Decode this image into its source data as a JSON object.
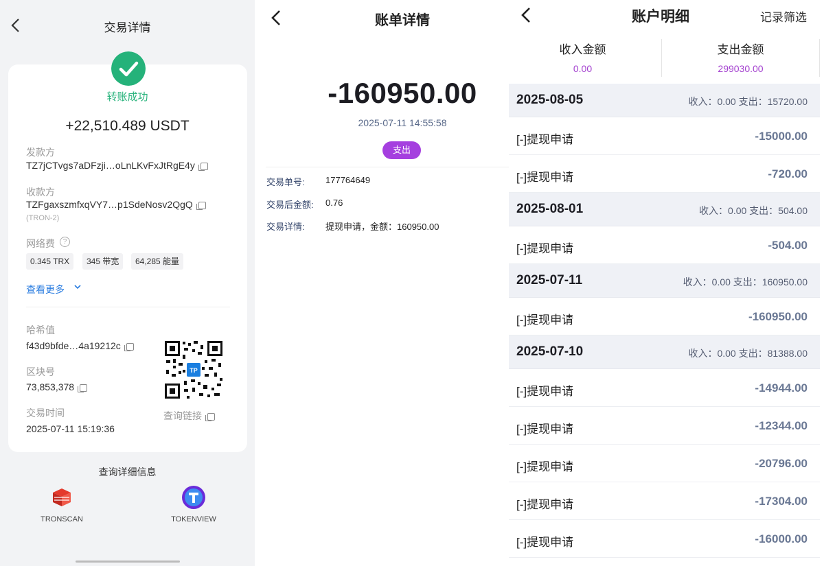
{
  "tx_detail": {
    "title": "交易详情",
    "status": "转账成功",
    "amount": "+22,510.489 USDT",
    "sender_label": "发款方",
    "sender_address": "TZ7jCTvgs7aDFzji…oLnLKvFxJtRgE4y",
    "receiver_label": "收款方",
    "receiver_address": "TZFgaxszmfxqVY7…p1SdeNosv2QgQ",
    "receiver_network": "(TRON-2)",
    "fee_label": "网络费",
    "fee_help": "?",
    "fees": [
      "0.345 TRX",
      "345 带宽",
      "64,285 能量"
    ],
    "see_more": "查看更多",
    "hash_label": "哈希值",
    "hash_value": "f43d9bfde…4a19212c",
    "block_label": "区块号",
    "block_value": "73,853,378",
    "time_label": "交易时间",
    "time_value": "2025-07-11 15:19:36",
    "query_link": "查询链接",
    "qr_logo": "TP",
    "detail_info_title": "查询详细信息",
    "explorers": [
      "TRONSCAN",
      "TOKENVIEW"
    ],
    "colors": {
      "success": "#25b27a",
      "link": "#2b7de0"
    }
  },
  "bill_detail": {
    "title": "账单详情",
    "amount": "-160950.00",
    "time": "2025-07-11 14:55:58",
    "type_badge": "支出",
    "order_no_label": "交易单号:",
    "order_no": "177764649",
    "balance_after_label": "交易后金额:",
    "balance_after": "0.76",
    "detail_label": "交易详情:",
    "detail_value": "提现申请，金额：160950.00",
    "colors": {
      "badge": "#a53fdf"
    }
  },
  "account_detail": {
    "title": "账户明细",
    "filter": "记录筛选",
    "income_label": "收入金额",
    "income_total": "0.00",
    "expense_label": "支出金额",
    "expense_total": "299030.00",
    "groups": [
      {
        "date": "2025-08-05",
        "summary": "收入：0.00  支出：15720.00",
        "items": [
          {
            "title": "[-]提现申请",
            "amount": "-15000.00"
          },
          {
            "title": "[-]提现申请",
            "amount": "-720.00"
          }
        ]
      },
      {
        "date": "2025-08-01",
        "summary": "收入：0.00  支出：504.00",
        "items": [
          {
            "title": "[-]提现申请",
            "amount": "-504.00"
          }
        ]
      },
      {
        "date": "2025-07-11",
        "summary": "收入：0.00  支出：160950.00",
        "items": [
          {
            "title": "[-]提现申请",
            "amount": "-160950.00"
          }
        ]
      },
      {
        "date": "2025-07-10",
        "summary": "收入：0.00  支出：81388.00",
        "items": [
          {
            "title": "[-]提现申请",
            "amount": "-14944.00"
          },
          {
            "title": "[-]提现申请",
            "amount": "-12344.00"
          },
          {
            "title": "[-]提现申请",
            "amount": "-20796.00"
          },
          {
            "title": "[-]提现申请",
            "amount": "-17304.00"
          },
          {
            "title": "[-]提现申请",
            "amount": "-16000.00"
          }
        ]
      }
    ],
    "colors": {
      "totals": "#a33fcf",
      "amount": "#6a7894"
    }
  }
}
